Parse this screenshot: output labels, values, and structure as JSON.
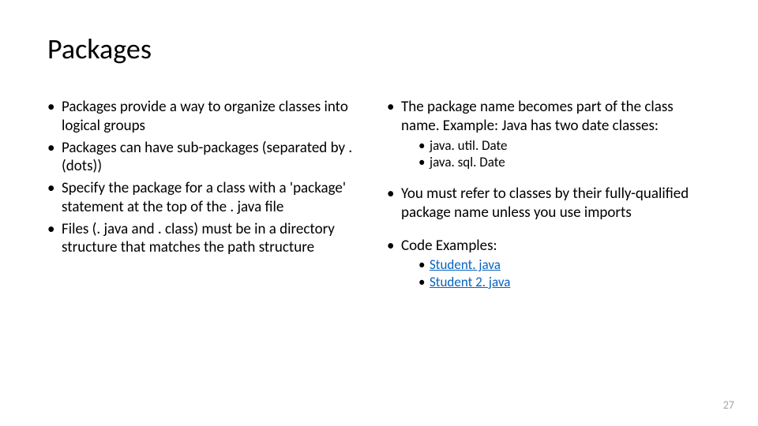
{
  "title": "Packages",
  "left": {
    "b1": "Packages provide a way to organize classes into logical groups",
    "b2": "Packages can have sub-packages (separated by . (dots))",
    "b3": "Specify the package for a class with a 'package' statement at the top of the . java file",
    "b4": "Files (. java and . class) must be in a directory structure that matches the path structure"
  },
  "right": {
    "b1": "The package name becomes part of the class name. Example: Java has two date classes:",
    "b1a": "java. util. Date",
    "b1b": "java. sql. Date",
    "b2": "You must refer to classes by their fully-qualified package name unless you use imports",
    "b3": "Code Examples:",
    "b3a": "Student. java",
    "b3b": "Student 2. java"
  },
  "pagenum": "27"
}
